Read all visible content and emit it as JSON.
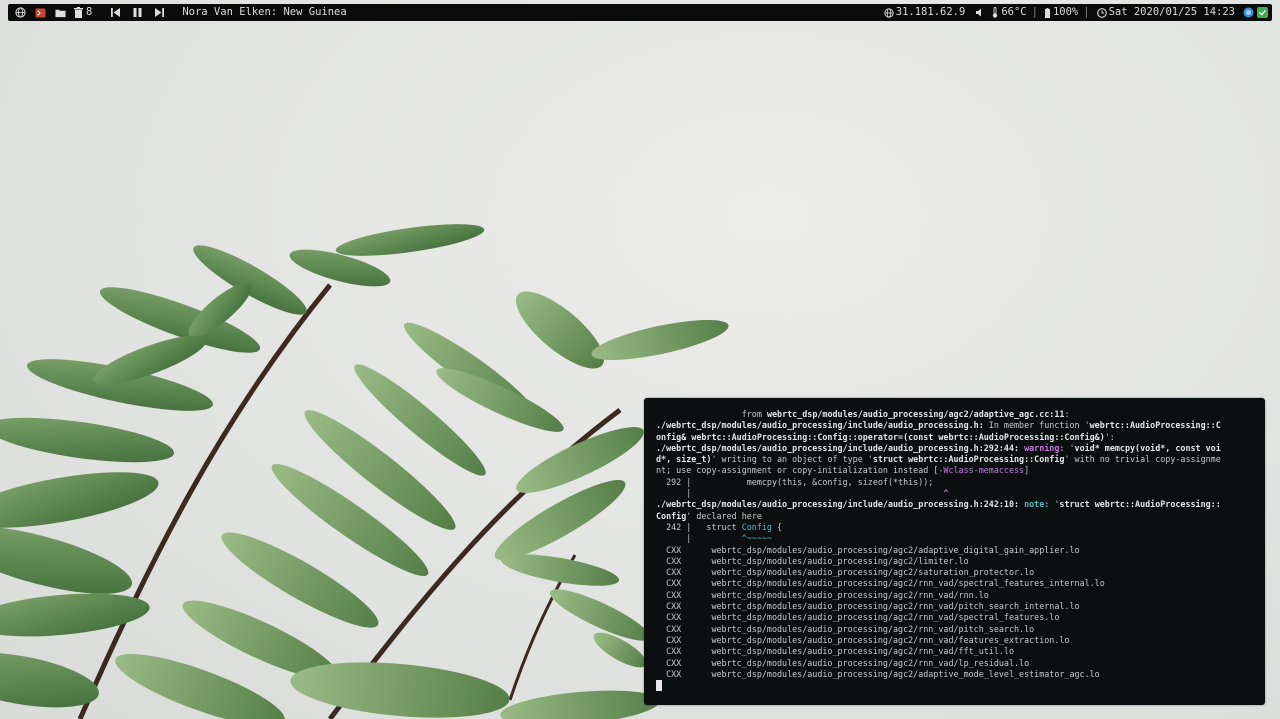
{
  "topbar": {
    "left": {
      "globe_icon": "globe-icon",
      "terminal_icon": "terminal-icon",
      "folder_icon": "folder-icon",
      "trash_icon": "trash-icon",
      "workspace_count": "8",
      "prev_icon": "skip-back-icon",
      "pause_icon": "pause-icon",
      "next_icon": "skip-forward-icon",
      "now_playing": "Nora Van Elken: New Guinea"
    },
    "right": {
      "ip": "31.181.62.9",
      "temperature": "66°C",
      "battery": "100%",
      "datetime": "Sat 2020/01/25 14:23"
    }
  },
  "terminal": {
    "lines": [
      {
        "segs": [
          {
            "t": "                 from "
          },
          {
            "t": "webrtc_dsp/modules/audio_processing/agc2/adaptive_agc.cc:11",
            "c": "b"
          },
          {
            "t": ":"
          }
        ]
      },
      {
        "segs": [
          {
            "t": "./webrtc_dsp/modules/audio_processing/include/audio_processing.h:",
            "c": "b"
          },
          {
            "t": " In member function '"
          },
          {
            "t": "webrtc::AudioProcessing::C",
            "c": "b"
          }
        ]
      },
      {
        "segs": [
          {
            "t": "onfig& webrtc::AudioProcessing::Config::operator=(const webrtc::AudioProcessing::Config&)",
            "c": "b"
          },
          {
            "t": "':"
          }
        ]
      },
      {
        "segs": [
          {
            "t": "./webrtc_dsp/modules/audio_processing/include/audio_processing.h:292:44:",
            "c": "b"
          },
          {
            "t": " "
          },
          {
            "t": "warning:",
            "c": "warn"
          },
          {
            "t": " '"
          },
          {
            "t": "void* memcpy(void*, const voi",
            "c": "b"
          }
        ]
      },
      {
        "segs": [
          {
            "t": "d*, size_t)",
            "c": "b"
          },
          {
            "t": "' writing to an object of type '"
          },
          {
            "t": "struct webrtc::AudioProcessing::Config",
            "c": "b"
          },
          {
            "t": "' with no trivial copy-assignme"
          }
        ]
      },
      {
        "segs": [
          {
            "t": "nt; use copy-assignment or copy-initialization instead ["
          },
          {
            "t": "-Wclass-memaccess",
            "c": "wflag"
          },
          {
            "t": "]"
          }
        ]
      },
      {
        "segs": [
          {
            "t": "  292 |           memcpy(this, &config, sizeof(*this));"
          }
        ]
      },
      {
        "segs": [
          {
            "t": "      |                                                  "
          },
          {
            "t": "^",
            "c": "warn"
          }
        ]
      },
      {
        "segs": [
          {
            "t": "./webrtc_dsp/modules/audio_processing/include/audio_processing.h:242:10:",
            "c": "b"
          },
          {
            "t": " "
          },
          {
            "t": "note:",
            "c": "note"
          },
          {
            "t": " '"
          },
          {
            "t": "struct webrtc::AudioProcessing::",
            "c": "b"
          }
        ]
      },
      {
        "segs": [
          {
            "t": "Config",
            "c": "b"
          },
          {
            "t": "' declared here"
          }
        ]
      },
      {
        "segs": [
          {
            "t": "  242 |   struct "
          },
          {
            "t": "Config",
            "c": "cyan"
          },
          {
            "t": " {"
          }
        ]
      },
      {
        "segs": [
          {
            "t": "      |          "
          },
          {
            "t": "^~~~~~",
            "c": "cyan"
          }
        ]
      },
      {
        "segs": [
          {
            "t": "  CXX      webrtc_dsp/modules/audio_processing/agc2/adaptive_digital_gain_applier.lo"
          }
        ]
      },
      {
        "segs": [
          {
            "t": "  CXX      webrtc_dsp/modules/audio_processing/agc2/limiter.lo"
          }
        ]
      },
      {
        "segs": [
          {
            "t": "  CXX      webrtc_dsp/modules/audio_processing/agc2/saturation_protector.lo"
          }
        ]
      },
      {
        "segs": [
          {
            "t": "  CXX      webrtc_dsp/modules/audio_processing/agc2/rnn_vad/spectral_features_internal.lo"
          }
        ]
      },
      {
        "segs": [
          {
            "t": "  CXX      webrtc_dsp/modules/audio_processing/agc2/rnn_vad/rnn.lo"
          }
        ]
      },
      {
        "segs": [
          {
            "t": "  CXX      webrtc_dsp/modules/audio_processing/agc2/rnn_vad/pitch_search_internal.lo"
          }
        ]
      },
      {
        "segs": [
          {
            "t": "  CXX      webrtc_dsp/modules/audio_processing/agc2/rnn_vad/spectral_features.lo"
          }
        ]
      },
      {
        "segs": [
          {
            "t": "  CXX      webrtc_dsp/modules/audio_processing/agc2/rnn_vad/pitch_search.lo"
          }
        ]
      },
      {
        "segs": [
          {
            "t": "  CXX      webrtc_dsp/modules/audio_processing/agc2/rnn_vad/features_extraction.lo"
          }
        ]
      },
      {
        "segs": [
          {
            "t": "  CXX      webrtc_dsp/modules/audio_processing/agc2/rnn_vad/fft_util.lo"
          }
        ]
      },
      {
        "segs": [
          {
            "t": "  CXX      webrtc_dsp/modules/audio_processing/agc2/rnn_vad/lp_residual.lo"
          }
        ]
      },
      {
        "segs": [
          {
            "t": "  CXX      webrtc_dsp/modules/audio_processing/agc2/adaptive_mode_level_estimator_agc.lo"
          }
        ]
      }
    ]
  },
  "colors": {
    "terminal_bg": "#0c0f10",
    "bar_bg": "#0b0b0b",
    "warning": "#c679dd",
    "note": "#56b6c2"
  }
}
